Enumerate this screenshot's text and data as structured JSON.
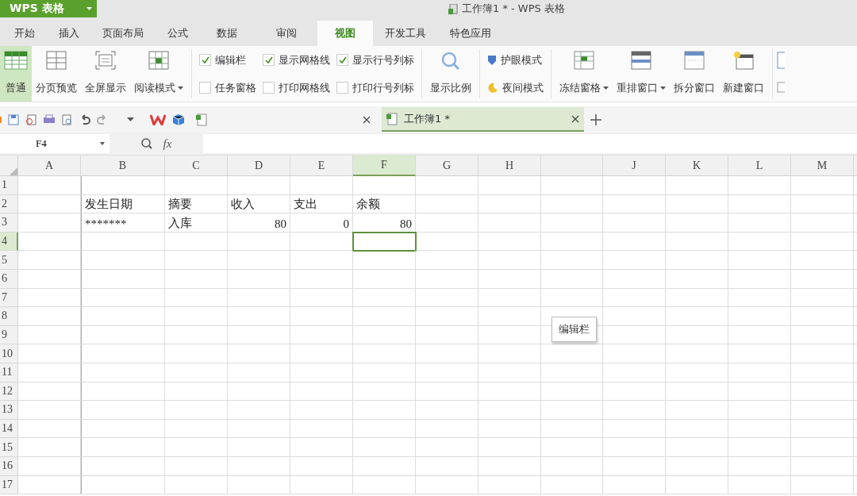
{
  "app_button": {
    "label": "WPS 表格"
  },
  "window": {
    "title": "工作簿1 * - WPS 表格"
  },
  "tabs": [
    {
      "label": "开始",
      "selected": false
    },
    {
      "label": "插入",
      "selected": false
    },
    {
      "label": "页面布局",
      "selected": false
    },
    {
      "label": "公式",
      "selected": false
    },
    {
      "label": "数据",
      "selected": false
    },
    {
      "label": "审阅",
      "selected": false
    },
    {
      "label": "视图",
      "selected": true
    },
    {
      "label": "开发工具",
      "selected": false
    },
    {
      "label": "特色应用",
      "selected": false
    }
  ],
  "ribbon": [
    {
      "kind": "large",
      "label": "普通",
      "selected": true,
      "dropdown": false
    },
    {
      "kind": "large",
      "label": "分页预览",
      "selected": false,
      "dropdown": false
    },
    {
      "kind": "large",
      "label": "全屏显示",
      "selected": false,
      "dropdown": false
    },
    {
      "kind": "large",
      "label": "阅读模式",
      "selected": false,
      "dropdown": true
    },
    {
      "kind": "divider"
    },
    {
      "kind": "checks",
      "items": [
        {
          "label": "编辑栏",
          "checked": true
        },
        {
          "label": "任务窗格",
          "checked": false
        }
      ]
    },
    {
      "kind": "checks",
      "items": [
        {
          "label": "显示网格线",
          "checked": true
        },
        {
          "label": "打印网格线",
          "checked": false
        }
      ]
    },
    {
      "kind": "checks",
      "items": [
        {
          "label": "显示行号列标",
          "checked": true
        },
        {
          "label": "打印行号列标",
          "checked": false
        }
      ]
    },
    {
      "kind": "divider"
    },
    {
      "kind": "large",
      "label": "显示比例",
      "selected": false,
      "dropdown": false
    },
    {
      "kind": "divider"
    },
    {
      "kind": "modes",
      "items": [
        {
          "label": "护眼模式"
        },
        {
          "label": "夜间模式"
        }
      ]
    },
    {
      "kind": "divider"
    },
    {
      "kind": "large",
      "label": "冻结窗格",
      "selected": false,
      "dropdown": true
    },
    {
      "kind": "large",
      "label": "重排窗口",
      "selected": false,
      "dropdown": true
    },
    {
      "kind": "large",
      "label": "拆分窗口",
      "selected": false,
      "dropdown": false
    },
    {
      "kind": "large",
      "label": "新建窗口",
      "selected": false,
      "dropdown": false
    }
  ],
  "doc_tabs": [
    {
      "selected": false
    },
    {
      "label": "工作簿1 *",
      "selected": true
    }
  ],
  "name_box": {
    "value": "F4"
  },
  "formula_bar": {
    "fx": "fx"
  },
  "tooltip": {
    "text": "编辑栏"
  },
  "columns": [
    {
      "label": "A",
      "selected": false
    },
    {
      "label": "B",
      "selected": false
    },
    {
      "label": "C",
      "selected": false
    },
    {
      "label": "D",
      "selected": false
    },
    {
      "label": "E",
      "selected": false
    },
    {
      "label": "F",
      "selected": true
    },
    {
      "label": "G",
      "selected": false
    },
    {
      "label": "H",
      "selected": false
    },
    {
      "covered": true,
      "selected": false
    },
    {
      "label": "J",
      "selected": false
    },
    {
      "label": "K",
      "selected": false
    },
    {
      "label": "L",
      "selected": false
    },
    {
      "label": "M",
      "selected": false
    }
  ],
  "rows": [
    {
      "label": "1",
      "selected": false,
      "cells": []
    },
    {
      "label": "2",
      "selected": false,
      "cells": [
        {
          "kind": "empty"
        },
        {
          "text": "发生日期",
          "kind": "text"
        },
        {
          "text": "摘要",
          "kind": "text"
        },
        {
          "text": "收入",
          "kind": "text"
        },
        {
          "text": "支出",
          "kind": "text"
        },
        {
          "text": "余额",
          "kind": "text"
        }
      ]
    },
    {
      "label": "3",
      "selected": false,
      "cells": [
        {
          "kind": "empty"
        },
        {
          "text": "*******",
          "kind": "text"
        },
        {
          "text": "入库",
          "kind": "text"
        },
        {
          "text": "80",
          "kind": "number"
        },
        {
          "text": "0",
          "kind": "number"
        },
        {
          "text": "80",
          "kind": "number"
        }
      ]
    },
    {
      "label": "4",
      "selected": true,
      "cells": []
    },
    {
      "label": "5",
      "selected": false,
      "cells": []
    },
    {
      "label": "6",
      "selected": false,
      "cells": []
    },
    {
      "label": "7",
      "selected": false,
      "cells": []
    },
    {
      "label": "8",
      "selected": false,
      "cells": []
    },
    {
      "label": "9",
      "selected": false,
      "cells": []
    },
    {
      "label": "10",
      "selected": false,
      "cells": []
    },
    {
      "label": "11",
      "selected": false,
      "cells": []
    },
    {
      "label": "12",
      "selected": false,
      "cells": []
    },
    {
      "label": "13",
      "selected": false,
      "cells": []
    },
    {
      "label": "14",
      "selected": false,
      "cells": []
    },
    {
      "label": "15",
      "selected": false,
      "cells": []
    },
    {
      "label": "16",
      "selected": false,
      "cells": []
    },
    {
      "label": "17",
      "selected": false,
      "cells": []
    }
  ]
}
